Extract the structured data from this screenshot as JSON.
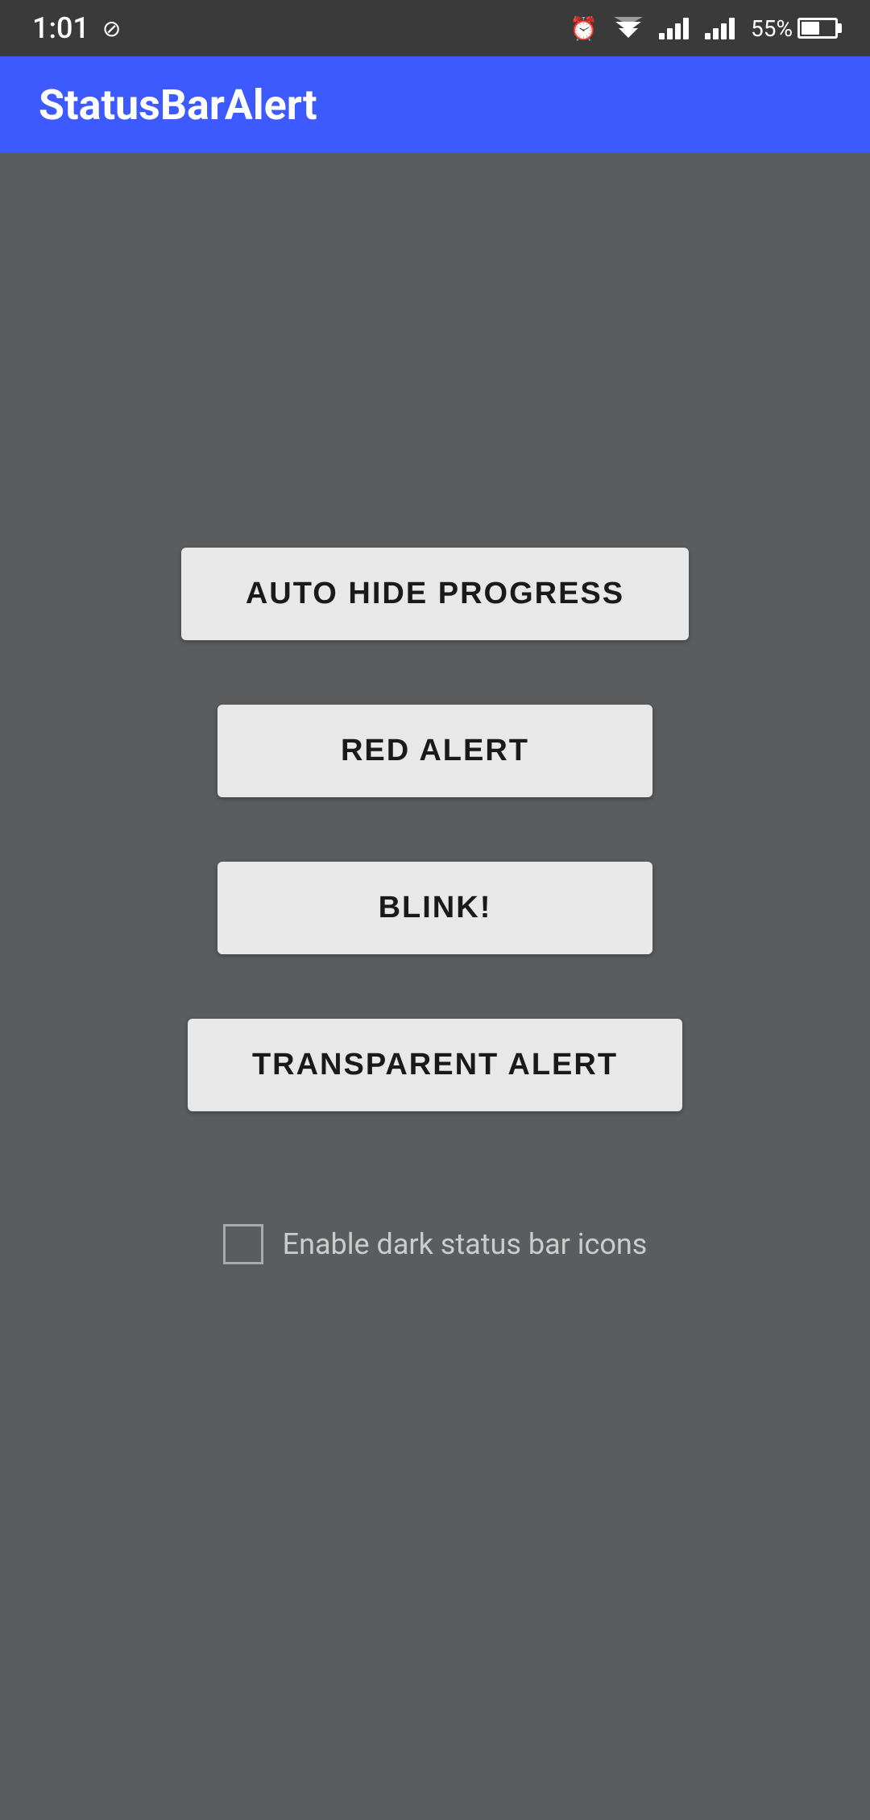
{
  "statusBar": {
    "time": "1:01",
    "batteryPercent": "55%",
    "icons": {
      "alarm": "⏰",
      "wifi": "▲",
      "signal1": "signal",
      "signal2": "signal",
      "battery": "battery"
    }
  },
  "appBar": {
    "title": "StatusBarAlert"
  },
  "buttons": [
    {
      "id": "auto-hide-progress",
      "label": "AUTO HIDE PROGRESS"
    },
    {
      "id": "red-alert",
      "label": "RED ALERT"
    },
    {
      "id": "blink",
      "label": "BLINK!"
    },
    {
      "id": "transparent-alert",
      "label": "TRANSPARENT ALERT"
    }
  ],
  "checkbox": {
    "label": "Enable dark status bar icons",
    "checked": false
  }
}
